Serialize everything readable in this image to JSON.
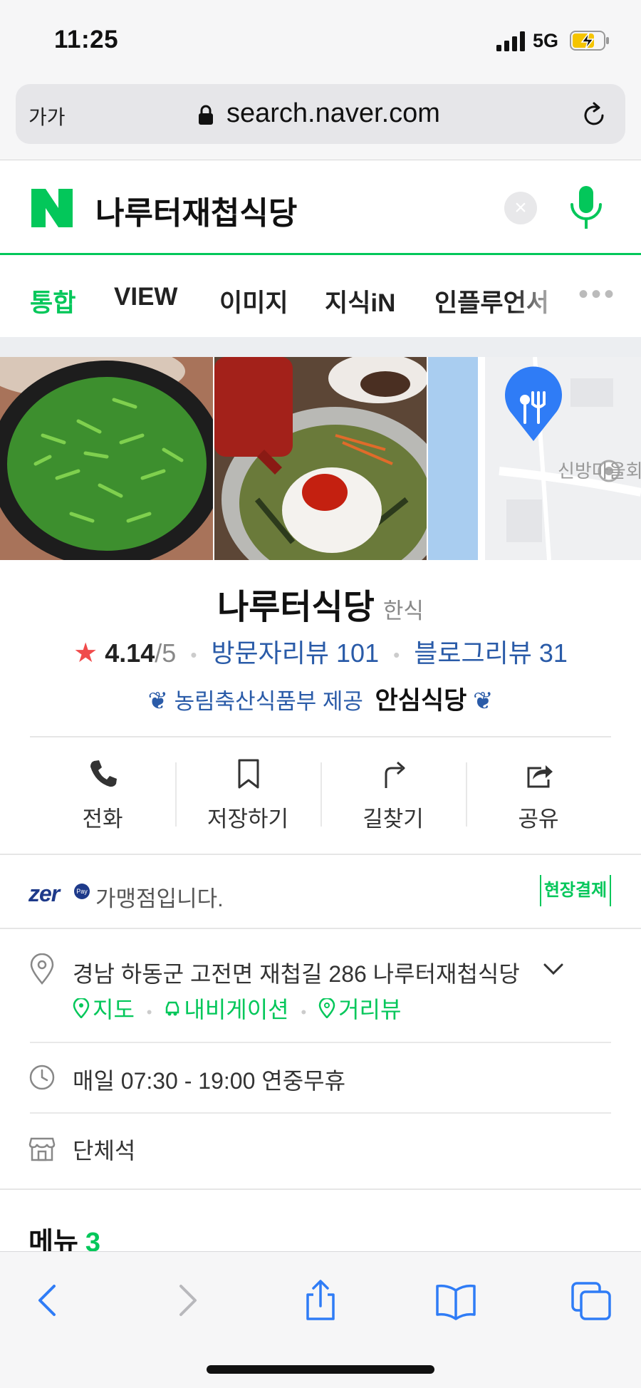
{
  "status_bar": {
    "time": "11:25",
    "network": "5G",
    "battery_icon": "battery-charging-icon"
  },
  "browser": {
    "text_size_label": "가가",
    "url": "search.naver.com"
  },
  "search": {
    "query": "나루터재첩식당",
    "clear_label": "×"
  },
  "tabs": [
    {
      "label": "통합",
      "active": true
    },
    {
      "label": "VIEW",
      "active": false
    },
    {
      "label": "이미지",
      "active": false
    },
    {
      "label": "지식iN",
      "active": false
    },
    {
      "label": "인플루언서",
      "active": false
    }
  ],
  "tabs_more": "•••",
  "map_label": "신방마을회",
  "place": {
    "name": "나루터식당",
    "category": "한식",
    "rating": "4.14",
    "rating_max": "/5",
    "visitor_reviews": "방문자리뷰 101",
    "blog_reviews": "블로그리뷰 31",
    "badge_provider": "농림축산식품부 제공",
    "badge_label": "안심식당"
  },
  "actions": [
    {
      "label": "전화",
      "icon": "phone-icon"
    },
    {
      "label": "저장하기",
      "icon": "bookmark-icon"
    },
    {
      "label": "길찾기",
      "icon": "directions-icon"
    },
    {
      "label": "공유",
      "icon": "share-icon"
    }
  ],
  "zeropay": {
    "logo": "zer",
    "pay": "Pay",
    "text": "가맹점입니다.",
    "onsite_label": "현장결제"
  },
  "address": {
    "text": "경남 하동군 고전면 재첩길 286 나루터재첩식당",
    "links": [
      "지도",
      "내비게이션",
      "거리뷰"
    ]
  },
  "hours": "매일 07:30 - 19:00 연중무휴",
  "facility": "단체석",
  "menu": {
    "title": "메뉴",
    "count": "3"
  },
  "colors": {
    "naver_green": "#03c75a",
    "link_blue": "#2a5ba8",
    "star_red": "#f04b4b",
    "ios_blue": "#2f7cf6"
  }
}
